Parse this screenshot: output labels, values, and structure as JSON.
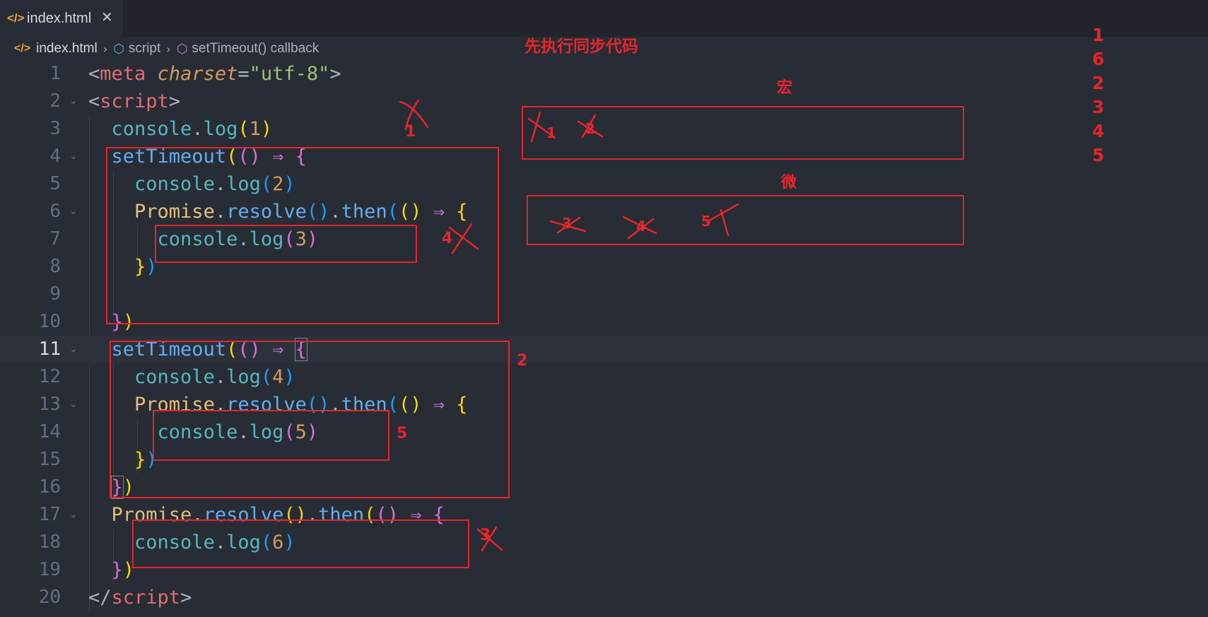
{
  "tab": {
    "icon": "html-code-icon",
    "title": "index.html",
    "close": "✕"
  },
  "breadcrumb": [
    {
      "label": "index.html",
      "icon": "html-code-icon"
    },
    {
      "label": "script",
      "icon": "cube-icon"
    },
    {
      "label": "setTimeout() callback",
      "icon": "cube-icon"
    }
  ],
  "editor": {
    "current_line": 11,
    "lines": [
      {
        "n": "1"
      },
      {
        "n": "2"
      },
      {
        "n": "3"
      },
      {
        "n": "4"
      },
      {
        "n": "5"
      },
      {
        "n": "6"
      },
      {
        "n": "7"
      },
      {
        "n": "8"
      },
      {
        "n": "9"
      },
      {
        "n": "10"
      },
      {
        "n": "11"
      },
      {
        "n": "12"
      },
      {
        "n": "13"
      },
      {
        "n": "14"
      },
      {
        "n": "15"
      },
      {
        "n": "16"
      },
      {
        "n": "17"
      },
      {
        "n": "18"
      },
      {
        "n": "19"
      },
      {
        "n": "20"
      }
    ],
    "tokens": {
      "l1": [
        "<",
        "meta",
        "charset",
        "=",
        "\"utf-8\"",
        ">"
      ],
      "l2": [
        "<",
        "script",
        ">"
      ],
      "l3": [
        "console",
        ".",
        "log",
        "(",
        "1",
        ")"
      ],
      "l4": [
        "setTimeout",
        "(",
        "()",
        "⇒",
        "{"
      ],
      "l5": [
        "console",
        ".",
        "log",
        "(",
        "2",
        ")"
      ],
      "l6": [
        "Promise",
        ".",
        "resolve",
        "()",
        ".",
        "then",
        "(",
        "()",
        "⇒",
        "{"
      ],
      "l7": [
        "console",
        ".",
        "log",
        "(",
        "3",
        ")"
      ],
      "l8": [
        "}",
        ")"
      ],
      "l10": [
        "}",
        ")"
      ],
      "l11": [
        "setTimeout",
        "(",
        "()",
        "⇒",
        "{"
      ],
      "l12": [
        "console",
        ".",
        "log",
        "(",
        "4",
        ")"
      ],
      "l13": [
        "Promise",
        ".",
        "resolve",
        "()",
        ".",
        "then",
        "(",
        "()",
        "⇒",
        "{"
      ],
      "l14": [
        "console",
        ".",
        "log",
        "(",
        "5",
        ")"
      ],
      "l15": [
        "}",
        ")"
      ],
      "l16": [
        "}",
        ")"
      ],
      "l17": [
        "Promise",
        ".",
        "resolve",
        "()",
        ".",
        "then",
        "(",
        "()",
        "⇒",
        "{"
      ],
      "l18": [
        "console",
        ".",
        "log",
        "(",
        "6",
        ")"
      ],
      "l19": [
        "}",
        ")"
      ],
      "l20": [
        "</",
        "script",
        ">"
      ]
    }
  },
  "annotations": {
    "heading": "先执行同步代码",
    "macro_label": "宏",
    "micro_label": "微",
    "output_order": [
      "1",
      "6",
      "2",
      "3",
      "4",
      "5"
    ],
    "marks": {
      "first_timeout": "1",
      "second_timeout": "2",
      "inner_log3": "4",
      "inner_log5": "5",
      "log6": "3",
      "macro_items": [
        "1",
        "2"
      ],
      "micro_items": [
        "3",
        "4",
        "5"
      ]
    }
  },
  "colors": {
    "annotation": "#e5252c",
    "background": "#282c34"
  }
}
